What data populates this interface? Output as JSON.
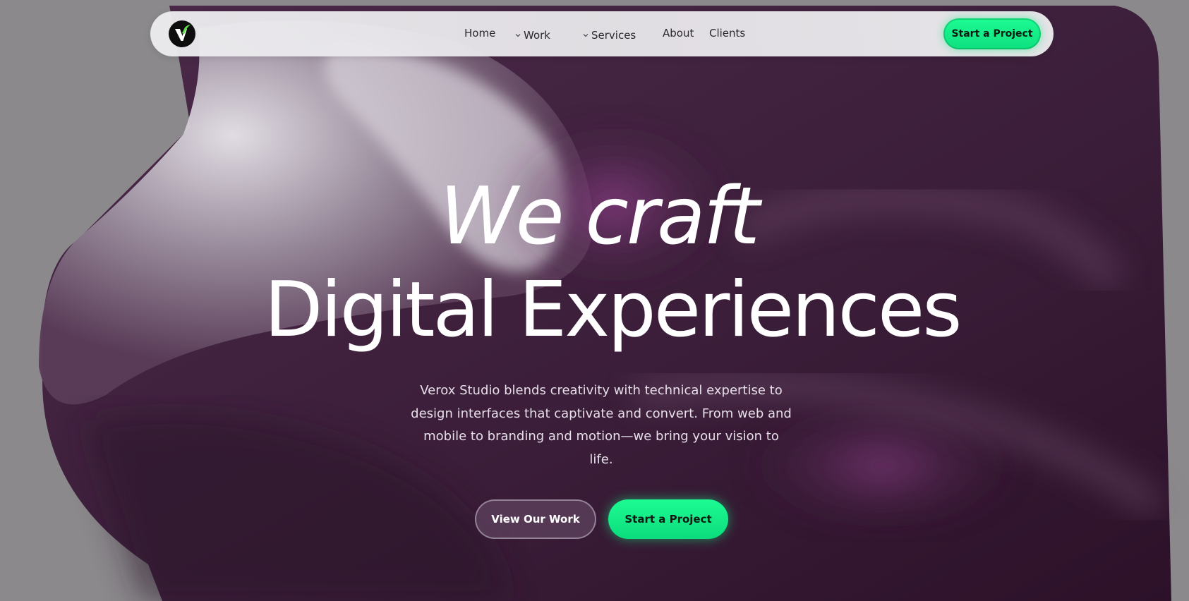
{
  "brand": {
    "logo_icon": "v-check-logo-icon",
    "accent": "#16f08a",
    "logo_check_color": "#5ee34a"
  },
  "nav": {
    "items": [
      {
        "label": "Home",
        "has_dropdown": false
      },
      {
        "label": "Work",
        "has_dropdown": true
      },
      {
        "label": "Services",
        "has_dropdown": true
      },
      {
        "label": "About",
        "has_dropdown": false
      },
      {
        "label": "Clients",
        "has_dropdown": false
      }
    ],
    "cta_label": "Start a Project"
  },
  "hero": {
    "title_line1": "We craft",
    "title_line2": "Digital Experiences",
    "subtitle": "Verox Studio blends creativity with technical expertise to design interfaces that captivate and convert. From web and mobile to branding and motion—we bring your vision to life.",
    "primary_button": "View Our Work",
    "secondary_button": "Start a Project"
  },
  "colors": {
    "background": "#8b898c",
    "shape_dark": "#3a1e38",
    "shape_light": "#cfc9d1",
    "text": "#ffffff"
  }
}
